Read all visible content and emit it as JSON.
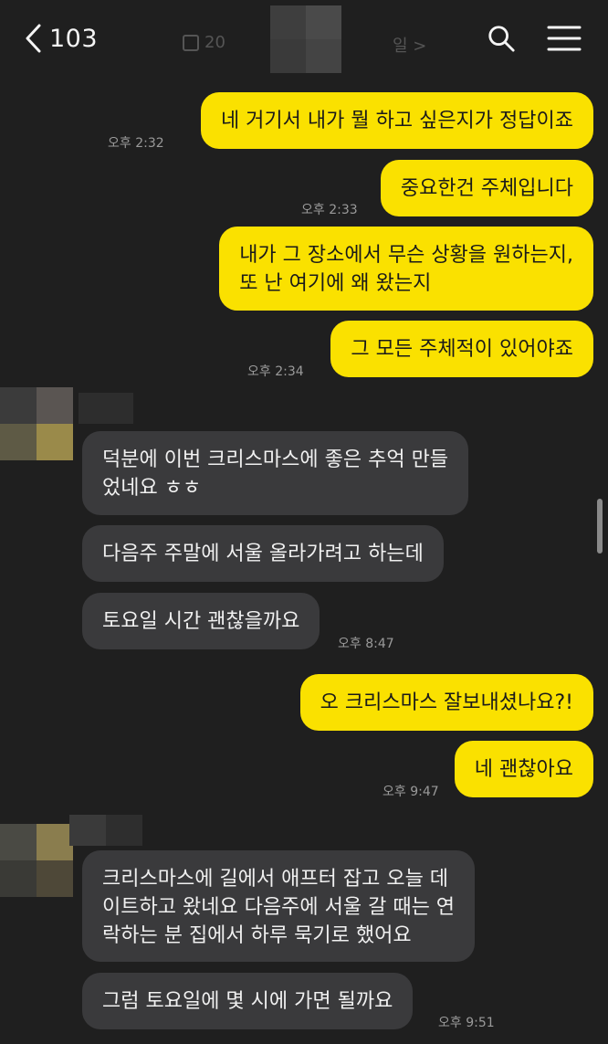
{
  "header": {
    "back_count": "103",
    "date_hint": "20",
    "date_hint_right": "일 >",
    "search_icon": "search-icon",
    "menu_icon": "hamburger-menu-icon"
  },
  "messages": [
    {
      "from": "me",
      "text": [
        "네 거기서 내가 뭘 하고 싶은지가 정답이죠"
      ],
      "time": "오후 2:32"
    },
    {
      "from": "me",
      "text": [
        "중요한건 주체입니다"
      ],
      "time": "오후 2:33"
    },
    {
      "from": "me",
      "text": [
        "내가 그 장소에서 무슨 상황을 원하는지,",
        "또 난 여기에 왜 왔는지"
      ],
      "time": ""
    },
    {
      "from": "me",
      "text": [
        "그 모든 주체적이 있어야죠"
      ],
      "time": "오후 2:34"
    },
    {
      "from": "other",
      "text": [
        "덕분에 이번 크리스마스에 좋은 추억 만들",
        "었네요 ㅎㅎ"
      ],
      "time": ""
    },
    {
      "from": "other",
      "text": [
        "다음주 주말에 서울 올라가려고 하는데"
      ],
      "time": ""
    },
    {
      "from": "other",
      "text": [
        "토요일 시간 괜찮을까요"
      ],
      "time": "오후 8:47"
    },
    {
      "from": "me",
      "text": [
        "오 크리스마스 잘보내셨나요?!"
      ],
      "time": ""
    },
    {
      "from": "me",
      "text": [
        "네 괜찮아요"
      ],
      "time": "오후 9:47"
    },
    {
      "from": "other",
      "text": [
        "크리스마스에 길에서 애프터 잡고 오늘 데",
        "이트하고 왔네요 다음주에 서울 갈 때는 연",
        "락하는 분 집에서 하루 묵기로 했어요"
      ],
      "time": ""
    },
    {
      "from": "other",
      "text": [
        "그럼 토요일에 몇 시에 가면 될까요"
      ],
      "time": "오후 9:51"
    }
  ],
  "colors": {
    "background": "#1f1f1f",
    "my_bubble": "#fae100",
    "other_bubble": "#3a3a3c",
    "timestamp": "#9a9a9a"
  }
}
